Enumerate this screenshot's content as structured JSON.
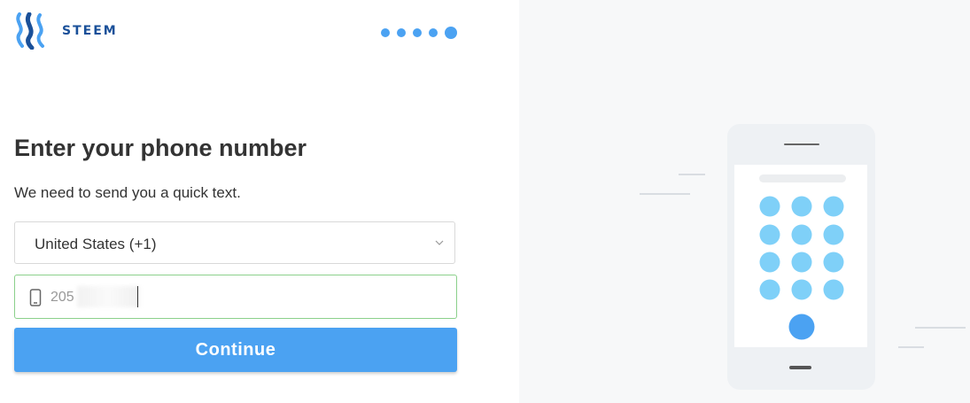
{
  "brand": {
    "name": "STEEM"
  },
  "steps": {
    "total": 5,
    "current": 5
  },
  "form": {
    "title": "Enter your phone number",
    "subtitle": "We need to send you a quick text.",
    "country_select": {
      "value": "United States (+1)"
    },
    "phone_input": {
      "value": "205"
    },
    "continue_label": "Continue"
  },
  "colors": {
    "accent": "#4ba2f2",
    "brand": "#1a5099",
    "input_focus_border": "#8bd08b",
    "keypad_key": "#7fd0f8",
    "keypad_call": "#4ba2f2"
  },
  "icons": [
    "steem-logo-icon",
    "chevron-down-icon",
    "mobile-phone-icon",
    "phone-keypad-illustration"
  ]
}
